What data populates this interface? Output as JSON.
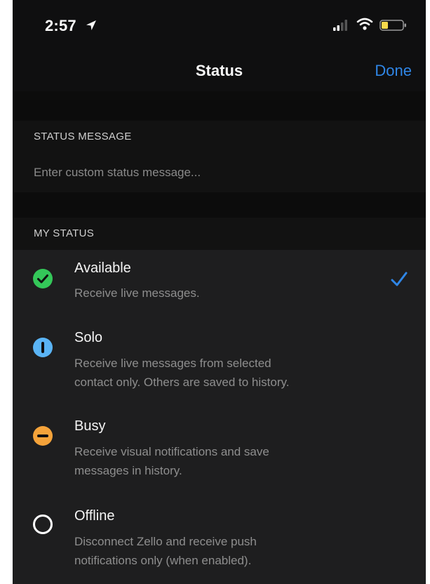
{
  "statusbar": {
    "time": "2:57"
  },
  "nav": {
    "title": "Status",
    "done_label": "Done"
  },
  "sections": {
    "status_message_header": "STATUS MESSAGE",
    "my_status_header": "MY STATUS"
  },
  "status_message": {
    "value": "",
    "placeholder": "Enter custom status message..."
  },
  "statuses": [
    {
      "title": "Available",
      "desc_lines": [
        "Receive live messages."
      ],
      "color": "#34c759",
      "icon": "check-circle-icon",
      "selected": true
    },
    {
      "title": "Solo",
      "desc_lines": [
        "Receive live messages from selected",
        "contact only. Others are saved to history."
      ],
      "color": "#5ab4f5",
      "icon": "solo-info-icon",
      "selected": false
    },
    {
      "title": "Busy",
      "desc_lines": [
        "Receive visual notifications and save",
        "messages in history."
      ],
      "color": "#f5a33a",
      "icon": "minus-circle-icon",
      "selected": false
    },
    {
      "title": "Offline",
      "desc_lines": [
        "Disconnect Zello and receive push",
        "notifications only (when enabled)."
      ],
      "color": "#ffffff",
      "icon": "empty-circle-icon",
      "selected": false
    }
  ],
  "accent_color": "#2f86e6"
}
